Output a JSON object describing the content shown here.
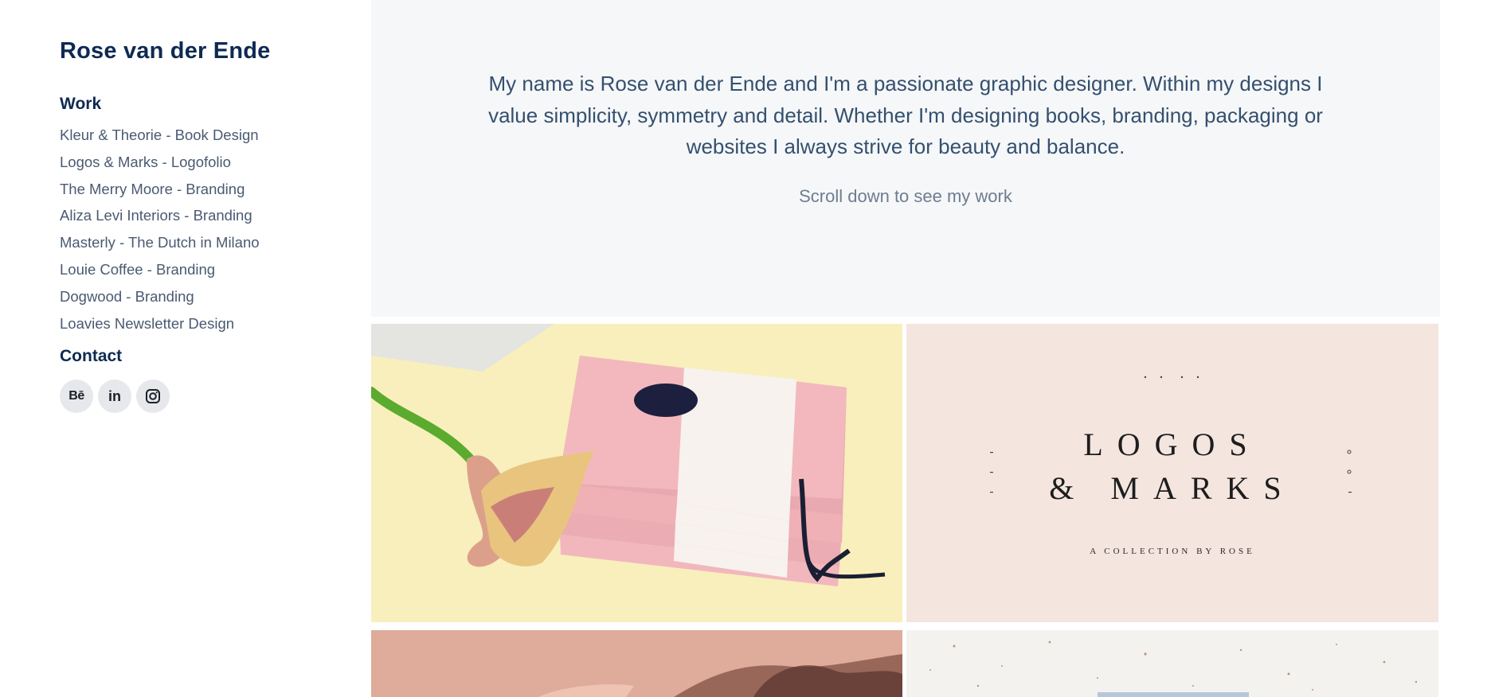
{
  "sidebar": {
    "title": "Rose van der Ende",
    "work_heading": "Work",
    "work_items": [
      "Kleur & Theorie - Book Design",
      "Logos & Marks - Logofolio",
      "The Merry Moore - Branding",
      "Aliza Levi Interiors - Branding",
      "Masterly - The Dutch in Milano",
      "Louie Coffee - Branding",
      "Dogwood - Branding",
      "Loavies Newsletter Design"
    ],
    "contact_heading": "Contact",
    "socials": {
      "behance": "Bē",
      "linkedin": "in",
      "instagram_icon": "instagram-icon"
    }
  },
  "hero": {
    "intro": "My name is Rose van der Ende and I'm a passionate graphic designer. Within my designs I value simplicity, symmetry and detail. Whether I'm designing books, branding, packaging or websites I always strive for beauty and balance.",
    "scroll_hint": "Scroll down to see my work"
  },
  "projects": {
    "logos_tile": {
      "line1": "LOGOS",
      "line2": "& MARKS",
      "subtitle": "A COLLECTION BY ROSE"
    }
  },
  "colors": {
    "heading": "#0e2a52",
    "link": "#4a5a72",
    "hero_bg": "#f6f7f9",
    "intro_text": "#34506e"
  }
}
